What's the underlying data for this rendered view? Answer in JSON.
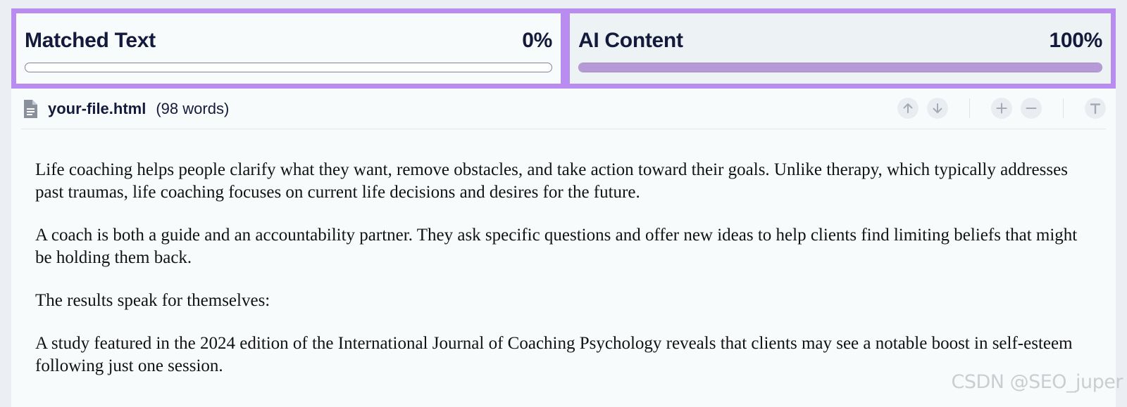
{
  "scores": {
    "matched": {
      "label": "Matched Text",
      "value_text": "0%",
      "value": 0
    },
    "ai": {
      "label": "AI Content",
      "value_text": "100%",
      "value": 100
    }
  },
  "file": {
    "name": "your-file.html",
    "word_count": "(98 words)",
    "icon": "document-icon"
  },
  "toolbar": {
    "icons": [
      "arrow-up-icon",
      "arrow-down-icon",
      "plus-icon",
      "minus-icon",
      "text-format-icon"
    ]
  },
  "content": {
    "paragraphs": [
      "Life coaching helps people clarify what they want, remove obstacles, and take action toward their goals. Unlike therapy, which typically addresses past traumas, life coaching focuses on current life decisions and desires for the future.",
      "A coach is both a guide and an accountability partner. They ask specific questions and offer new ideas to help clients find limiting beliefs that might be holding them back.",
      "The results speak for themselves:",
      "A study featured in the 2024 edition of the International Journal of Coaching Psychology reveals that clients may see a notable boost in self-esteem following just one session."
    ]
  },
  "watermark": "CSDN @SEO_juper",
  "colors": {
    "panel_border": "#b98cf0",
    "ai_bar_fill": "#b69ad8",
    "text_dark": "#141a3c"
  }
}
